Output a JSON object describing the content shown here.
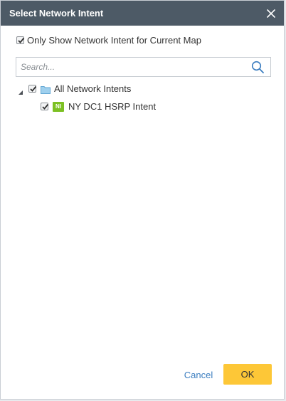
{
  "dialog": {
    "title": "Select Network Intent",
    "close_icon": "close-icon"
  },
  "filter": {
    "label": "Only Show Network Intent for Current Map",
    "checked": true
  },
  "search": {
    "placeholder": "Search...",
    "value": "",
    "icon": "search-icon"
  },
  "tree": {
    "root": {
      "label": "All Network Intents",
      "expanded": true,
      "checked": true,
      "icon": "folder-icon"
    },
    "children": [
      {
        "badge": "NI",
        "label": "NY DC1 HSRP Intent",
        "checked": true
      }
    ]
  },
  "footer": {
    "cancel_label": "Cancel",
    "ok_label": "OK"
  },
  "colors": {
    "titlebar": "#4d5a66",
    "ok_button": "#fdc737",
    "cancel_link": "#3c7ec0",
    "ni_badge": "#7cc023",
    "folder": "#9fd0ee"
  }
}
